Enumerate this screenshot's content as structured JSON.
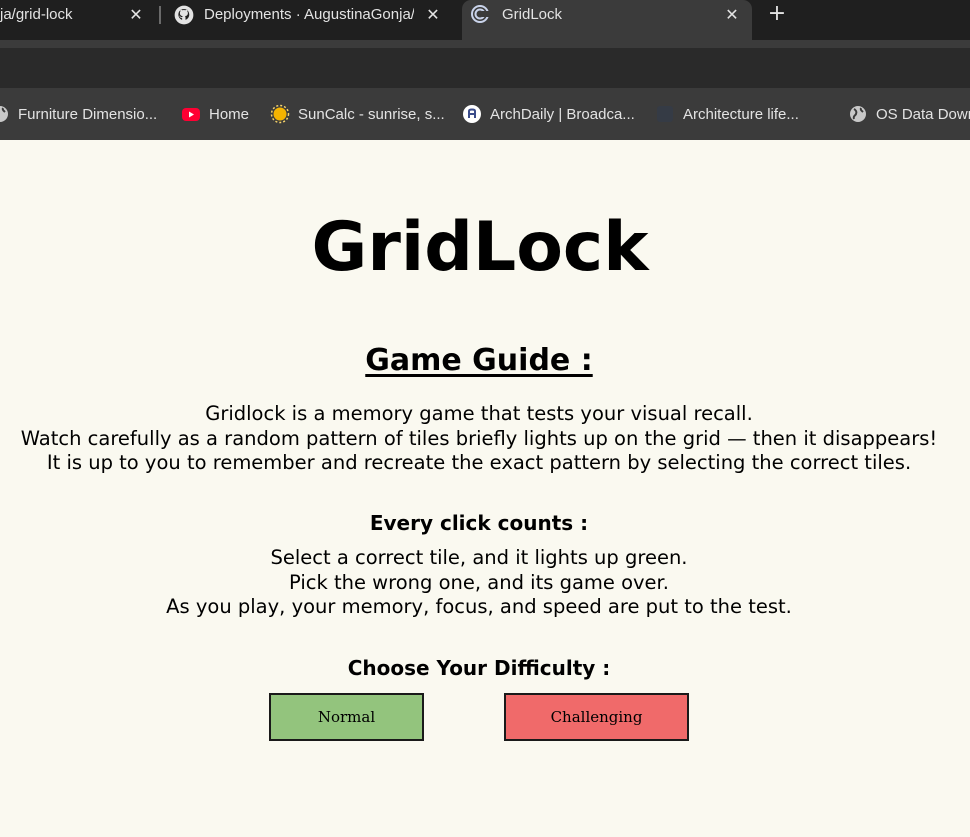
{
  "browser": {
    "tabs": [
      {
        "title": "ja/grid-lock",
        "active": false
      },
      {
        "title": "Deployments · AugustinaGonja/",
        "active": false,
        "icon": "github-icon"
      },
      {
        "title": "GridLock",
        "active": true,
        "icon": "gridlock-icon"
      }
    ],
    "new_tab_symbol": "+",
    "close_symbol": "✕",
    "bookmarks": [
      {
        "label": "Furniture Dimensio...",
        "icon": "globe-icon"
      },
      {
        "label": "Home",
        "icon": "youtube-icon"
      },
      {
        "label": "SunCalc - sunrise, s...",
        "icon": "sun-icon"
      },
      {
        "label": "ArchDaily | Broadca...",
        "icon": "archdaily-icon"
      },
      {
        "label": "Architecture life...",
        "icon": "dark-site-icon"
      },
      {
        "label": "OS Data Down",
        "icon": "globe-icon"
      }
    ]
  },
  "page": {
    "title": "GridLock",
    "guide_heading": "Game Guide :",
    "intro_lines": [
      "Gridlock is a memory game that tests your visual recall.",
      "Watch carefully as a random pattern of tiles briefly lights up on the grid — then it disappears!",
      "It is up to you to remember and recreate the exact pattern by selecting the correct tiles."
    ],
    "clicks_heading": "Every click counts :",
    "rule_lines": [
      "Select a correct tile, and it lights up green.",
      "Pick the wrong one, and its game over.",
      "As you play, your memory, focus, and speed are put to the test."
    ],
    "difficulty_heading": "Choose Your Difficulty :",
    "buttons": {
      "normal": "Normal",
      "challenging": "Challenging"
    }
  },
  "colors": {
    "page_background": "#faf9f0",
    "normal_button": "#93c47d",
    "challenging_button": "#f06a6a",
    "tabstrip": "#1f1f1f",
    "active_tab": "#3b3b3b"
  }
}
